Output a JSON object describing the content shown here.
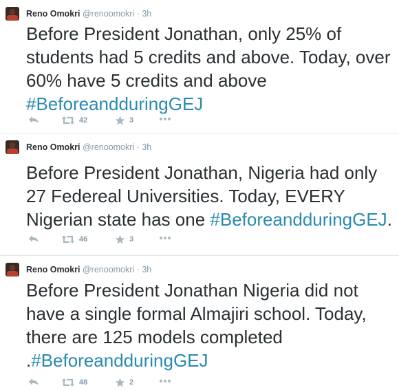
{
  "colors": {
    "hashtag": "#2a8ab0",
    "muted": "#8899a6",
    "text": "#292f33"
  },
  "icons": [
    "reply-icon",
    "retweet-icon",
    "star-icon",
    "more-icon"
  ],
  "tweets": [
    {
      "name": "Reno Omokri",
      "handle": "@renoomokri",
      "sep": "·",
      "time": "3h",
      "text": "Before President Jonathan, only 25% of\nstudents had 5 credits and above. Today, over\n60% have 5 credits and above\n",
      "hashtag": "#BeforeandduringGEJ",
      "suffix": "",
      "retweets": "42",
      "favorites": "3"
    },
    {
      "name": "Reno Omokri",
      "handle": "@renoomokri",
      "sep": "·",
      "time": "3h",
      "text": "Before President Jonathan, Nigeria had only\n27 Federeal Universities. Today, EVERY\nNigerian state has one ",
      "hashtag": "#BeforeandduringGEJ",
      "suffix": ".",
      "retweets": "46",
      "favorites": "3"
    },
    {
      "name": "Reno Omokri",
      "handle": "@renoomokri",
      "sep": "·",
      "time": "3h",
      "text": "Before President Jonathan Nigeria did not\nhave a single formal Almajiri school. Today,\nthere are 125 models completed\n.",
      "hashtag": "#BeforeandduringGEJ",
      "suffix": "",
      "retweets": "48",
      "favorites": "2"
    }
  ]
}
